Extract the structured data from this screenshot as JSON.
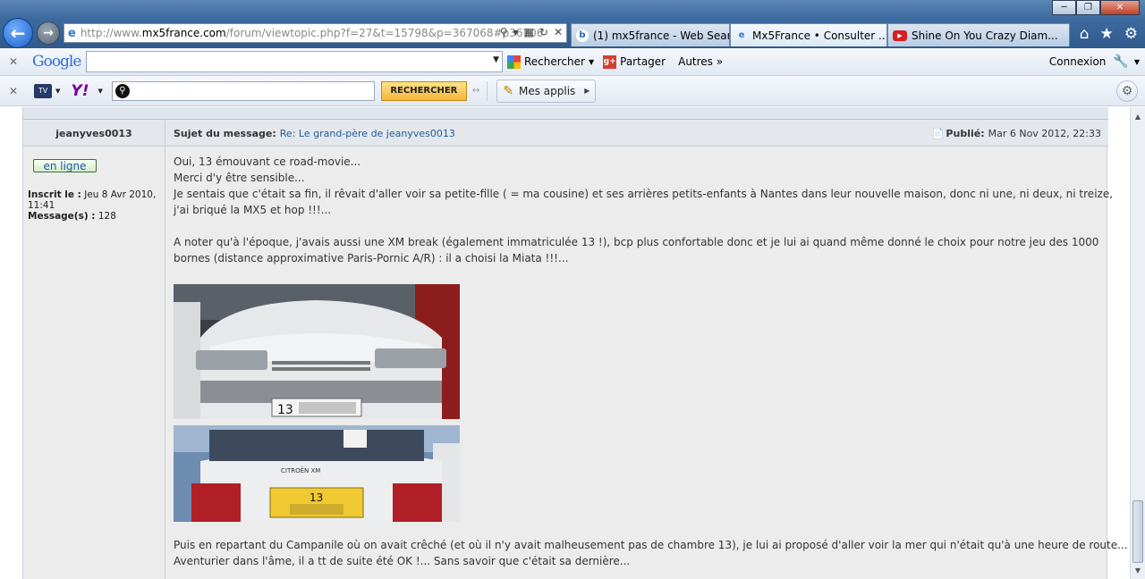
{
  "browser": {
    "address": {
      "prefix": "http://www.",
      "domain": "mx5france.com",
      "path": "/forum/viewtopic.php?f=27&t=15798&p=367068#p36706"
    },
    "tabs": [
      {
        "label": "(1) mx5france - Web Searc...",
        "icon": "bing-icon"
      },
      {
        "label": "Mx5France • Consulter ...",
        "icon": "ie-icon"
      },
      {
        "label": "Shine On You Crazy Diam...",
        "icon": "youtube-icon"
      }
    ]
  },
  "google_toolbar": {
    "logo": "Google",
    "search_label": "Rechercher",
    "share_label": "Partager",
    "more_label": "Autres »",
    "login_label": "Connexion"
  },
  "yahoo_toolbar": {
    "logo": "Y!",
    "search_button": "RECHERCHER",
    "apps_label": "Mes applis"
  },
  "post": {
    "author": "jeanyves0013",
    "subject_label": "Sujet du message:",
    "subject": "Re: Le grand-père de jeanyves0013",
    "published_label": "Publié:",
    "published": "Mar 6 Nov 2012, 22:33",
    "online_badge": "en ligne",
    "registered_label": "Inscrit le :",
    "registered": "Jeu 8 Avr 2010, 11:41",
    "messages_label": "Message(s) :",
    "messages": "128",
    "lines": [
      "Oui, 13 émouvant ce road-movie...",
      "Merci d'y être sensible...",
      "Je sentais que c'était sa fin, il rêvait d'aller voir sa petite-fille ( = ma cousine) et ses arrières petits-enfants à Nantes dans leur nouvelle maison, donc ni une, ni deux, ni treize,",
      "j'ai briqué la MX5 et hop !!!...",
      "A noter qu'à l'époque, j'avais aussi une XM break (également immatriculée 13 !), bcp plus confortable donc et je lui ai quand même donné le choix pour notre jeu des 1000",
      "bornes (distance approximative Paris-Pornic A/R) : il a choisi la Miata !!!...",
      "Puis en repartant du Campanile où on avait crêché (et où il n'y avait malheusement pas de chambre 13), je lui ai proposé d'aller voir la mer qui n'était qu'à une heure de route...",
      "Aventurier dans l'âme, il a tt de suite été OK !... Sans savoir que c'était sa dernière..."
    ],
    "plate_front": "13",
    "plate_rear": "13",
    "rear_badge": "CITROËN XM"
  }
}
